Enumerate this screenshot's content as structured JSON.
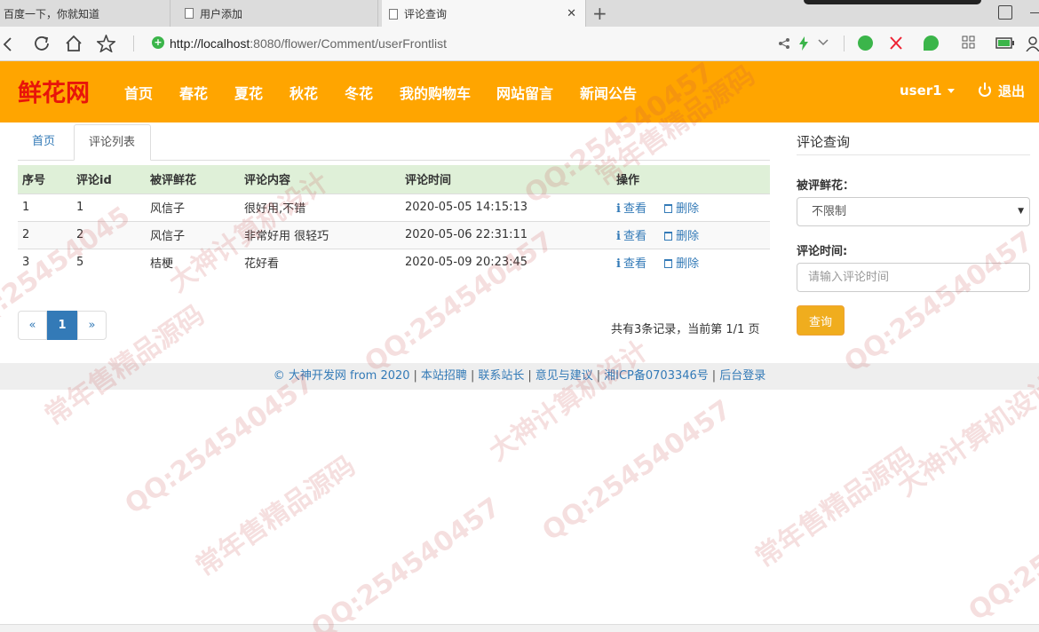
{
  "browser": {
    "tabs": [
      {
        "title": "百度一下，你就知道"
      },
      {
        "title": "用户添加"
      },
      {
        "title": "评论查询",
        "active": true
      }
    ],
    "url_host": "http://localhost",
    "url_rest": ":8080/flower/Comment/userFrontlist",
    "close_glyph": "✕",
    "new_tab_glyph": "+",
    "icons": [
      "back-icon",
      "reload-icon",
      "home-icon",
      "star-icon",
      "share-icon",
      "bolt-icon",
      "chevron-down-icon"
    ]
  },
  "site": {
    "brand": "鲜花网",
    "brand_color": "#e8150a",
    "nav_color": "#ffa500",
    "nav": [
      "首页",
      "春花",
      "夏花",
      "秋花",
      "冬花",
      "我的购物车",
      "网站留言",
      "新闻公告"
    ],
    "user": "user1",
    "logout": "退出"
  },
  "content": {
    "tabs": [
      "首页",
      "评论列表"
    ],
    "columns": [
      "序号",
      "评论id",
      "被评鲜花",
      "评论内容",
      "评论时间",
      "操作"
    ],
    "rows": [
      {
        "no": "1",
        "id": "1",
        "flower": "风信子",
        "content": "很好用,不错",
        "time": "2020-05-05 14:15:13"
      },
      {
        "no": "2",
        "id": "2",
        "flower": "风信子",
        "content": "非常好用 很轻巧",
        "time": "2020-05-06 22:31:11"
      },
      {
        "no": "3",
        "id": "5",
        "flower": "桔梗",
        "content": "花好看",
        "time": "2020-05-09 20:23:45"
      }
    ],
    "view_label": "查看",
    "delete_label": "删除",
    "pager": {
      "prev": "«",
      "current": "1",
      "next": "»"
    },
    "summary": "共有3条记录，当前第 1/1 页"
  },
  "search": {
    "title": "评论查询",
    "flower_label": "被评鲜花：",
    "flower_value": "不限制",
    "time_label": "评论时间:",
    "time_placeholder": "请输入评论时间",
    "button": "查询"
  },
  "footer": {
    "items": [
      "© 大神开发网 from 2020",
      "本站招聘",
      "联系站长",
      "意见与建议",
      "湘ICP备0703346号",
      "后台登录"
    ]
  },
  "watermark": {
    "lines": [
      "QQ:25454045",
      "大神计算机设计",
      "常年售精品源码",
      "QQ:254540457"
    ]
  }
}
